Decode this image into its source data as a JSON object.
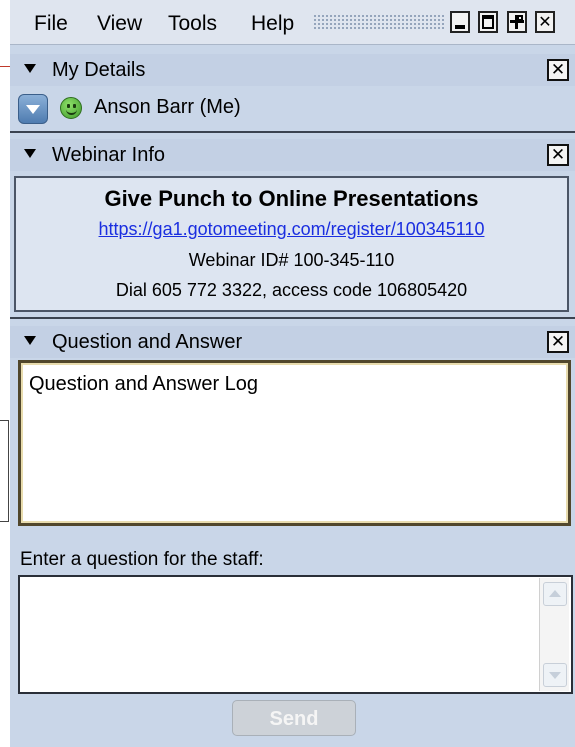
{
  "menu": {
    "items": [
      {
        "label": "File"
      },
      {
        "label": "View"
      },
      {
        "label": "Tools"
      },
      {
        "label": "Help"
      }
    ]
  },
  "window_controls": [
    "minimize-icon",
    "maximize-icon",
    "undock-icon",
    "close-icon"
  ],
  "my_details": {
    "header": "My Details",
    "user_name": "Anson Barr (Me)",
    "status_icon": "green-smiley-icon"
  },
  "webinar_info": {
    "header": "Webinar Info",
    "title": "Give Punch to Online Presentations",
    "link": "https://ga1.gotomeeting.com/register/100345110",
    "webinar_id": "Webinar ID# 100-345-110",
    "dial": "Dial 605 772 3322, access code 106805420"
  },
  "question_answer": {
    "header": "Question and Answer",
    "log_title": "Question and Answer Log",
    "input_label": "Enter a question for the staff:",
    "input_value": "",
    "send_label": "Send"
  },
  "colors": {
    "panel_bg": "#c9d6e8",
    "header_bg": "#c3d0e4",
    "link": "#1a2ee0",
    "log_border": "#51472c"
  }
}
